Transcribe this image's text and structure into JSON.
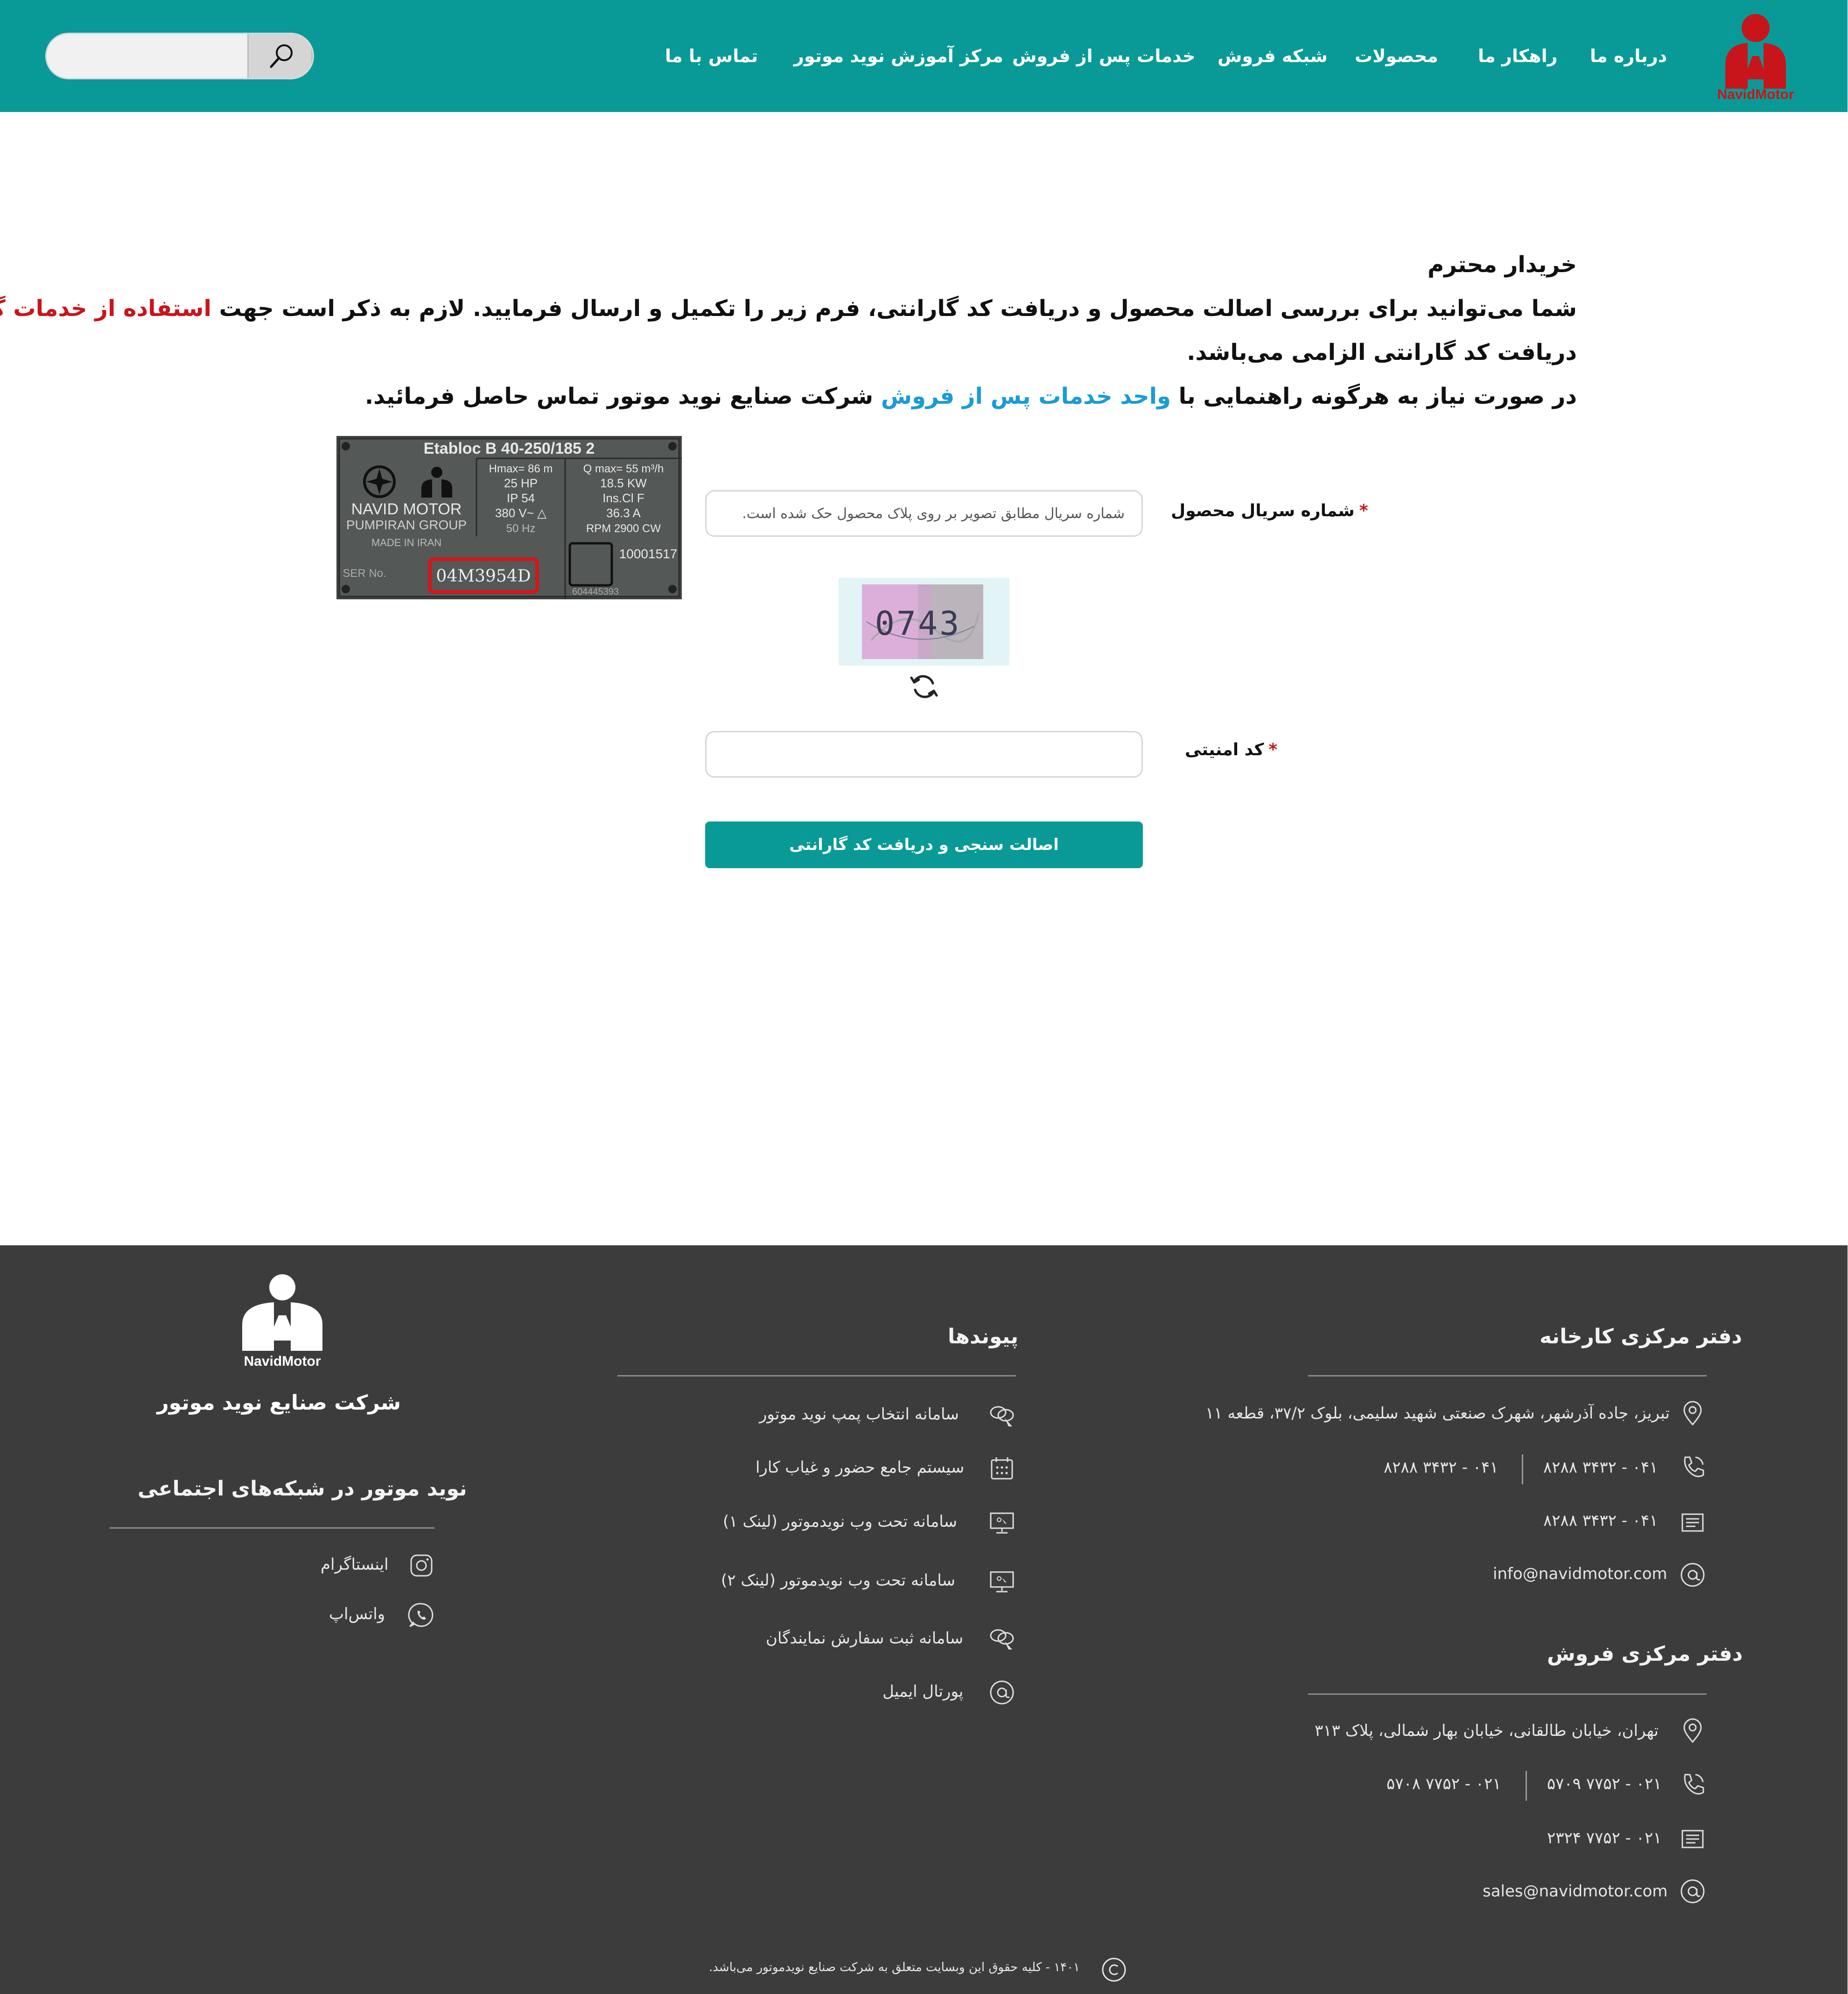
{
  "brand": {
    "logo_text": "NavidMotor"
  },
  "nav": {
    "items": [
      "درباره ما",
      "راهکار ما",
      "محصولات",
      "شبکه فروش",
      "خدمات پس از فروش",
      "مرکز آموزش نوید موتور",
      "تماس با ما"
    ]
  },
  "search": {
    "placeholder": "",
    "icon": "search-icon"
  },
  "intro": {
    "greeting": "خریدار محترم",
    "line2_part1": "شما می‌توانید برای بررسی اصالت محصول و دریافت کد گارانتی، فرم زیر را تکمیل و ارسال فرمایید. لازم به ذکر است جهت ",
    "line2_highlight": "استفاده از خدمات گارانتی",
    "line2_end": "،",
    "line3": "دریافت کد گارانتی الزامی می‌باشد.",
    "line4_part1": "در صورت نیاز به هرگونه راهنمایی با ",
    "line4_link": "واحد خدمات پس از فروش",
    "line4_part2": " شرکت صنایع نوید موتور تماس حاصل فرمائید."
  },
  "plate": {
    "model": "Etabloc  B 40-250/185 2",
    "hmax": "Hmax= 86  m",
    "qmax": "Q max= 55  m³/h",
    "hp": "25 HP",
    "kw": "18.5 KW",
    "ip": "IP 54",
    "ins": "Ins.Cl  F",
    "volt": "380 V~ △",
    "amp": "36.3 A",
    "hz": "50 Hz",
    "rpm": "RPM  2900 CW",
    "maker": "NAVID MOTOR",
    "group": "PUMPIRAN GROUP",
    "made": "MADE IN IRAN",
    "ser_label": "SER No.",
    "serial": "04M3954D",
    "num1": "10001517",
    "num2": "604445393"
  },
  "form": {
    "serial_label": "شماره سریال محصول",
    "serial_placeholder": "شماره سریال مطابق تصویر بر روی پلاک محصول حک شده است.",
    "required_mark": "*",
    "captcha_text": "0743",
    "security_label": "کد امنیتی",
    "security_value": "",
    "submit_label": "اصالت سنجی و دریافت کد گارانتی"
  },
  "footer": {
    "factory": {
      "title": "دفتر مرکزی کارخانه",
      "address": "تبریز، جاده آذرشهر، شهرک صنعتی شهید سلیمی، بلوک ۳۷/۲، قطعه ۱۱",
      "phone1": "۰۴۱ - ۳۴۳۲ ۸۲۸۸",
      "phone2": "۰۴۱ - ۳۴۳۲ ۸۲۸۸",
      "fax": "۰۴۱ - ۳۴۳۲ ۸۲۸۸",
      "email": "info@navidmotor.com"
    },
    "sales": {
      "title": "دفتر مرکزی فروش",
      "address": "تهران، خیابان طالقانی، خیابان بهار شمالی، پلاک ۳۱۳",
      "phone1": "۰۲۱ - ۷۷۵۲ ۵۷۰۹",
      "phone2": "۰۲۱ - ۷۷۵۲ ۵۷۰۸",
      "fax": "۰۲۱ - ۷۷۵۲ ۲۳۲۴",
      "email": "sales@navidmotor.com"
    },
    "links": {
      "title": "پیوندها",
      "items": [
        "سامانه انتخاب پمپ نوید موتور",
        "سیستم جامع حضور و غیاب کارا",
        "سامانه تحت وب نویدموتور (لینک ۱)",
        "سامانه تحت وب نویدموتور (لینک ۲)",
        "سامانه ثبت سفارش نمایندگان",
        "پورتال ایمیل"
      ]
    },
    "company": {
      "logo_text": "NavidMotor",
      "name": "شرکت صنایع نوید موتور",
      "social_title": "نوید موتور در شبکه‌های اجتماعی",
      "instagram": "اینستاگرام",
      "whatsapp": "واتس‌اپ"
    },
    "copyright": "۱۴۰۱ - کلیه حقوق این وبسایت متعلق به شرکت صنایع نویدموتور می‌باشد."
  },
  "colors": {
    "primary": "#099a97",
    "brand_red": "#c8151b",
    "link_blue": "#1a9bd7",
    "footer_bg": "#3c3c3c"
  }
}
